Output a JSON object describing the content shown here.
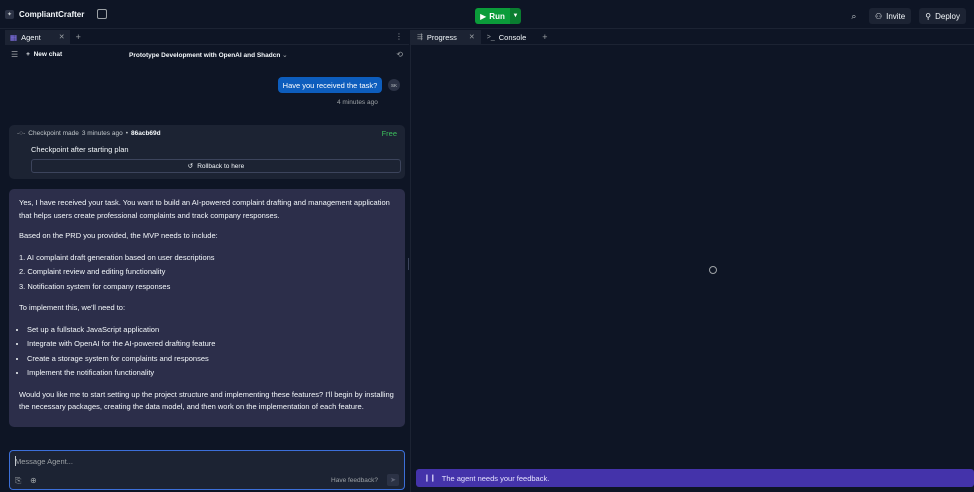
{
  "app": {
    "name": "CompliantCrafter",
    "run_label": "Run",
    "invite_label": "Invite",
    "deploy_label": "Deploy"
  },
  "left_panel": {
    "tab_label": "Agent",
    "new_chat_label": "New chat",
    "chat_title": "Prototype Development with OpenAI and Shadcn",
    "user_message": "Have you received the task?",
    "user_avatar": "SK",
    "user_message_time": "4 minutes ago",
    "checkpoint": {
      "prefix": "Checkpoint made",
      "time": "3 minutes ago",
      "hash": "86acb69d",
      "badge": "Free",
      "title": "Checkpoint after starting plan",
      "rollback_label": "Rollback to here"
    },
    "agent_message": {
      "intro": "Yes, I have received your task. You want to build an AI-powered complaint drafting and management application that helps users create professional complaints and track company responses.",
      "prd_intro": "Based on the PRD you provided, the MVP needs to include:",
      "mvp_items": [
        "1. AI complaint draft generation based on user descriptions",
        "2. Complaint review and editing functionality",
        "3. Notification system for company responses"
      ],
      "implement_intro": "To implement this, we'll need to:",
      "implement_items": [
        "Set up a fullstack JavaScript application",
        "Integrate with OpenAI for the AI-powered drafting feature",
        "Create a storage system for complaints and responses",
        "Implement the notification functionality"
      ],
      "closing": "Would you like me to start setting up the project structure and implementing these features? I'll begin by installing the necessary packages, creating the data model, and then work on the implementation of each feature."
    },
    "composer": {
      "placeholder": "Message Agent...",
      "feedback_label": "Have feedback?"
    }
  },
  "right_panel": {
    "tabs": [
      {
        "label": "Progress"
      },
      {
        "label": "Console"
      }
    ],
    "feedback_banner": "The agent needs your feedback."
  },
  "colors": {
    "background": "#0e1525",
    "run_green": "#0b9c3a",
    "user_bubble": "#0d5dbd",
    "agent_bubble": "#2c2e4a",
    "feedback_banner": "#4433aa",
    "free_badge": "#3cbf5c"
  }
}
